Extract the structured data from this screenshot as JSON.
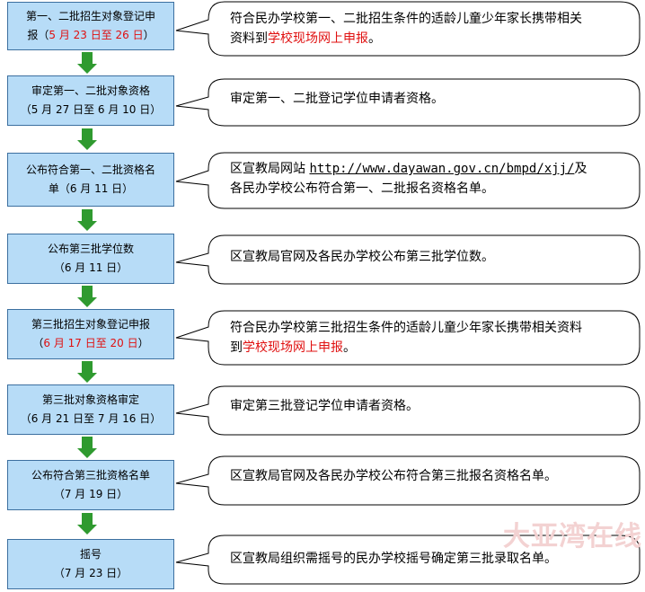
{
  "steps": [
    {
      "line1": "第一、二批招生对象登记申",
      "line2_pre": "报（",
      "line2_red": "5 月 23 日至 26 日",
      "line2_post": "）"
    },
    {
      "line1": "审定第一、二批对象资格",
      "line2": "（5 月 27 日至 6 月 10 日）"
    },
    {
      "line1": "公布符合第一、二批资格名",
      "line2": "单（6 月 11 日）"
    },
    {
      "line1": "公布第三批学位数",
      "line2": "（6 月 11 日）"
    },
    {
      "line1": "第三批招生对象登记申报",
      "line2_pre": "（",
      "line2_red": "6 月 17 日至 20 日",
      "line2_post": "）"
    },
    {
      "line1": "第三批对象资格审定",
      "line2": "（6 月 21 日至 7 月 16 日）"
    },
    {
      "line1": "公布符合第三批资格名单",
      "line2": "（7 月 19 日）"
    },
    {
      "line1": "摇号",
      "line2": "（7 月 23 日）"
    }
  ],
  "notes": [
    {
      "line1": "符合民办学校第一、二批招生条件的适龄儿童少年家长携带相关",
      "line2_pre": "资料到",
      "line2_red": "学校现场网上申报",
      "line2_post": "。"
    },
    {
      "line1": "审定第一、二批登记学位申请者资格。"
    },
    {
      "line1_pre": "区宣教局网站 ",
      "url": "http://www.dayawan.gov.cn/bmpd/xjj/",
      "line1_post": "及",
      "line2": "各民办学校公布符合第一、二批报名资格名单。"
    },
    {
      "line1": "区宣教局官网及各民办学校公布第三批学位数。"
    },
    {
      "line1": "符合民办学校第三批招生条件的适龄儿童少年家长携带相关资料",
      "line2_pre": "到",
      "line2_red": "学校现场网上申报",
      "line2_post": "。"
    },
    {
      "line1": "审定第三批登记学位申请者资格。"
    },
    {
      "line1": "区宣教局官网及各民办学校公布符合第三批报名资格名单。"
    },
    {
      "line1": "区宣教局组织需摇号的民办学校摇号确定第三批录取名单。"
    }
  ],
  "watermark": "大亚湾在线",
  "colors": {
    "box_fill": "#b7dcf7",
    "box_border": "#3c6f9f",
    "arrow": "#2f9a2f",
    "highlight_red": "#e01010"
  }
}
